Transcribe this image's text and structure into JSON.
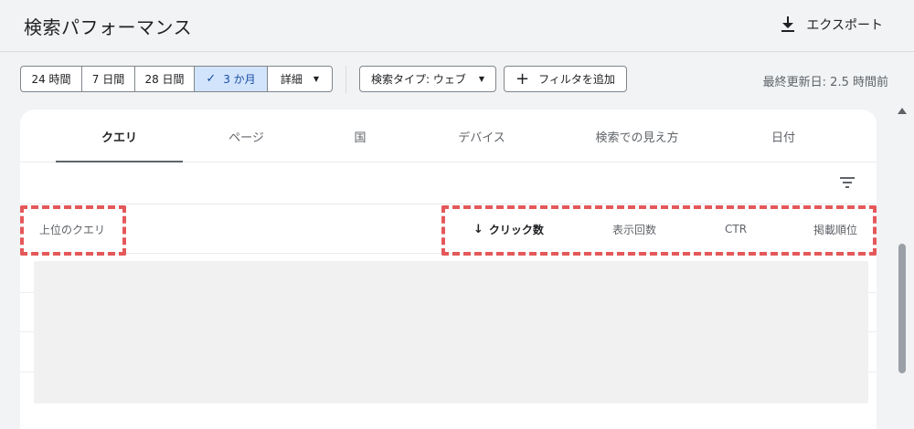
{
  "header": {
    "title": "検索パフォーマンス",
    "export_label": "エクスポート",
    "export_icon": "download-icon"
  },
  "date_range": {
    "options": [
      {
        "label": "24 時間",
        "active": false
      },
      {
        "label": "7 日間",
        "active": false
      },
      {
        "label": "28 日間",
        "active": false
      },
      {
        "label": "3 か月",
        "active": true
      }
    ],
    "active_check": "✓",
    "details_label": "詳細"
  },
  "filters": {
    "search_type_label": "検索タイプ: ウェブ",
    "add_filter_label": "フィルタを追加",
    "add_icon": "plus-icon"
  },
  "last_updated": "最終更新日: 2.5 時間前",
  "tabs": [
    {
      "label": "クエリ",
      "active": true
    },
    {
      "label": "ページ",
      "active": false
    },
    {
      "label": "国",
      "active": false
    },
    {
      "label": "デバイス",
      "active": false
    },
    {
      "label": "検索での見え方",
      "active": false
    },
    {
      "label": "日付",
      "active": false
    }
  ],
  "table": {
    "row_header": "上位のクエリ",
    "columns": [
      {
        "label": "クリック数",
        "sorted": true,
        "sort_direction": "descending"
      },
      {
        "label": "表示回数",
        "sorted": false
      },
      {
        "label": "CTR",
        "sorted": false
      },
      {
        "label": "掲載順位",
        "sorted": false
      }
    ],
    "filter_icon": "filter-list-icon"
  },
  "colors": {
    "active_segment_bg": "#d2e3fc",
    "highlight_border": "#e5585a",
    "page_bg": "#f1f3f4"
  }
}
